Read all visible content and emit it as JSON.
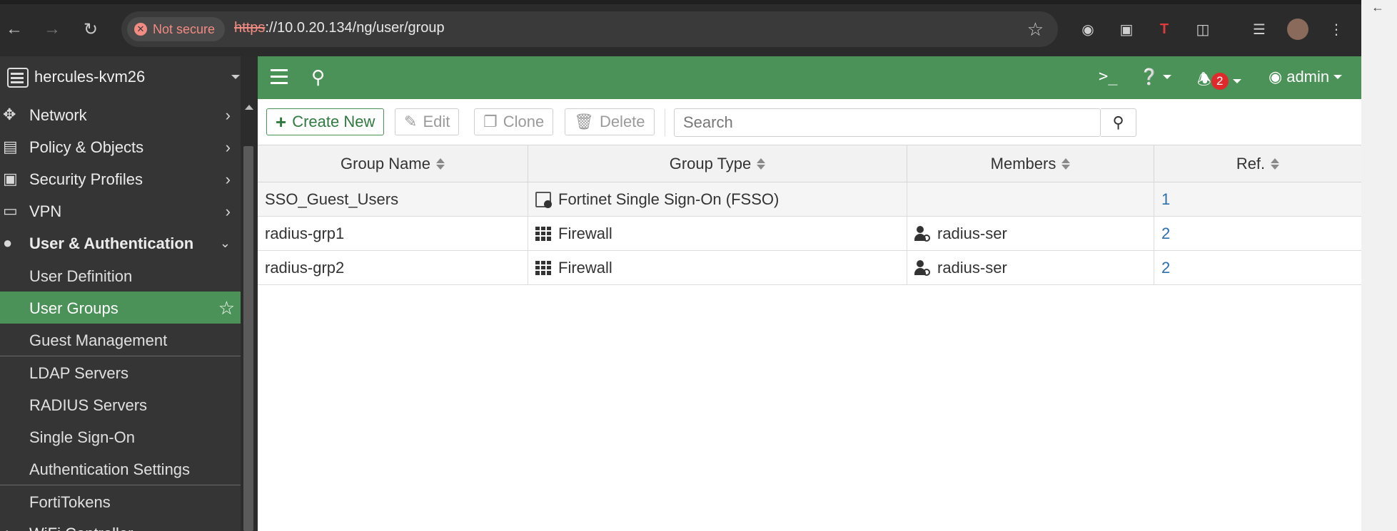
{
  "browser": {
    "security_label": "Not secure",
    "url_scheme": "https",
    "url_rest": "://10.0.20.134/ng/user/group"
  },
  "sidebar": {
    "device_name": "hercules-kvm26",
    "items": [
      {
        "label": "Network",
        "icon": "network-icon"
      },
      {
        "label": "Policy & Objects",
        "icon": "policy-icon"
      },
      {
        "label": "Security Profiles",
        "icon": "lock-icon"
      },
      {
        "label": "VPN",
        "icon": "laptop-icon"
      },
      {
        "label": "User & Authentication",
        "icon": "user-icon"
      }
    ],
    "subitems": [
      {
        "label": "User Definition"
      },
      {
        "label": "User Groups"
      },
      {
        "label": "Guest Management"
      },
      {
        "label": "LDAP Servers"
      },
      {
        "label": "RADIUS Servers"
      },
      {
        "label": "Single Sign-On"
      },
      {
        "label": "Authentication Settings"
      },
      {
        "label": "FortiTokens"
      }
    ],
    "next_item_partial": "WiFi Controller"
  },
  "header": {
    "notification_count": "2",
    "user_label": "admin"
  },
  "toolbar": {
    "create_label": "Create New",
    "edit_label": "Edit",
    "clone_label": "Clone",
    "delete_label": "Delete",
    "search_placeholder": "Search"
  },
  "table": {
    "columns": [
      "Group Name",
      "Group Type",
      "Members",
      "Ref."
    ],
    "rows": [
      {
        "name": "SSO_Guest_Users",
        "type": "Fortinet Single Sign-On (FSSO)",
        "type_icon": "sso-icon",
        "members": "",
        "ref": "1"
      },
      {
        "name": "radius-grp1",
        "type": "Firewall",
        "type_icon": "firewall-icon",
        "members": "radius-ser",
        "ref": "2"
      },
      {
        "name": "radius-grp2",
        "type": "Firewall",
        "type_icon": "firewall-icon",
        "members": "radius-ser",
        "ref": "2"
      }
    ]
  },
  "colors": {
    "accent_green": "#4a9257",
    "sidebar_bg": "#353535",
    "link_blue": "#2a6fb0",
    "badge_red": "#e0292b"
  }
}
